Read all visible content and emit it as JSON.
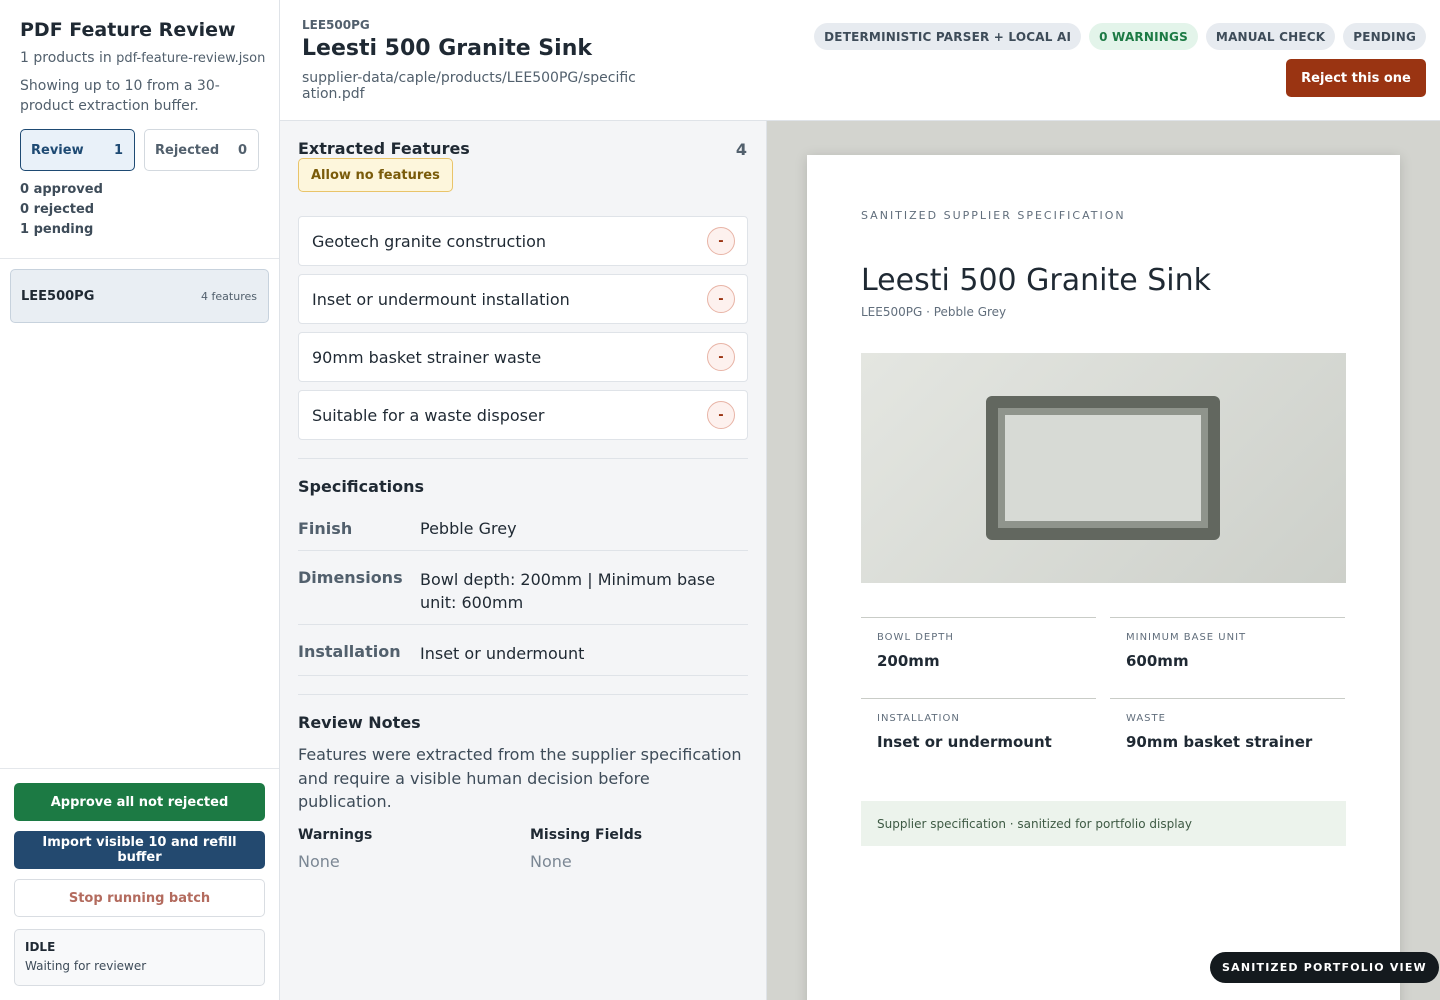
{
  "sidebar": {
    "title": "PDF Feature Review",
    "product_count_prefix": "1 products in",
    "product_count_file": "pdf-feature-review.json",
    "buffer_note": "Showing up to 10 from a 30-product extraction buffer.",
    "tabs": [
      {
        "label": "Review",
        "count": "1"
      },
      {
        "label": "Rejected",
        "count": "0"
      }
    ],
    "stats": {
      "approved": "0 approved",
      "rejected": "0 rejected",
      "pending": "1 pending"
    },
    "products": [
      {
        "code": "LEE500PG",
        "features": "4 features"
      }
    ],
    "actions": {
      "approve_all": "Approve all not rejected",
      "import_refill": "Import visible 10 and refill buffer",
      "stop_batch": "Stop running batch"
    },
    "status": {
      "state": "IDLE",
      "message": "Waiting for reviewer"
    }
  },
  "header": {
    "code": "LEE500PG",
    "title": "Leesti 500 Granite Sink",
    "path": "supplier-data/caple/products/LEE500PG/specification.pdf",
    "badges": [
      {
        "label": "DETERMINISTIC PARSER + LOCAL AI",
        "tone": "neutral"
      },
      {
        "label": "0 WARNINGS",
        "tone": "success"
      },
      {
        "label": "MANUAL CHECK",
        "tone": "neutral"
      },
      {
        "label": "PENDING",
        "tone": "neutral"
      }
    ],
    "reject_label": "Reject this one"
  },
  "features": {
    "title": "Extracted Features",
    "count": "4",
    "allow_none_label": "Allow no features",
    "remove_symbol": "-",
    "items": [
      "Geotech granite construction",
      "Inset or undermount installation",
      "90mm basket strainer waste",
      "Suitable for a waste disposer"
    ]
  },
  "specifications": {
    "title": "Specifications",
    "rows": [
      {
        "label": "Finish",
        "value": "Pebble Grey"
      },
      {
        "label": "Dimensions",
        "value": "Bowl depth: 200mm | Minimum base unit: 600mm"
      },
      {
        "label": "Installation",
        "value": "Inset or undermount"
      }
    ]
  },
  "review_notes": {
    "title": "Review Notes",
    "text": "Features were extracted from the supplier specification and require a visible human decision before publication.",
    "warnings_label": "Warnings",
    "warnings_value": "None",
    "missing_label": "Missing Fields",
    "missing_value": "None"
  },
  "document": {
    "kicker": "SANITIZED SUPPLIER SPECIFICATION",
    "title": "Leesti 500 Granite Sink",
    "subtitle": "LEE500PG · Pebble Grey",
    "cells": [
      {
        "label": "BOWL DEPTH",
        "value": "200mm"
      },
      {
        "label": "MINIMUM BASE UNIT",
        "value": "600mm"
      },
      {
        "label": "INSTALLATION",
        "value": "Inset or undermount"
      },
      {
        "label": "WASTE",
        "value": "90mm basket strainer"
      }
    ],
    "footer": "Supplier specification · sanitized for portfolio display",
    "portfolio_badge": "SANITIZED PORTFOLIO VIEW"
  },
  "colors": {
    "primary": "#1e4a73",
    "approve": "#1c7a44",
    "import": "#23496f",
    "reject": "#9a3412",
    "warning_bg": "#fdf6dc"
  }
}
